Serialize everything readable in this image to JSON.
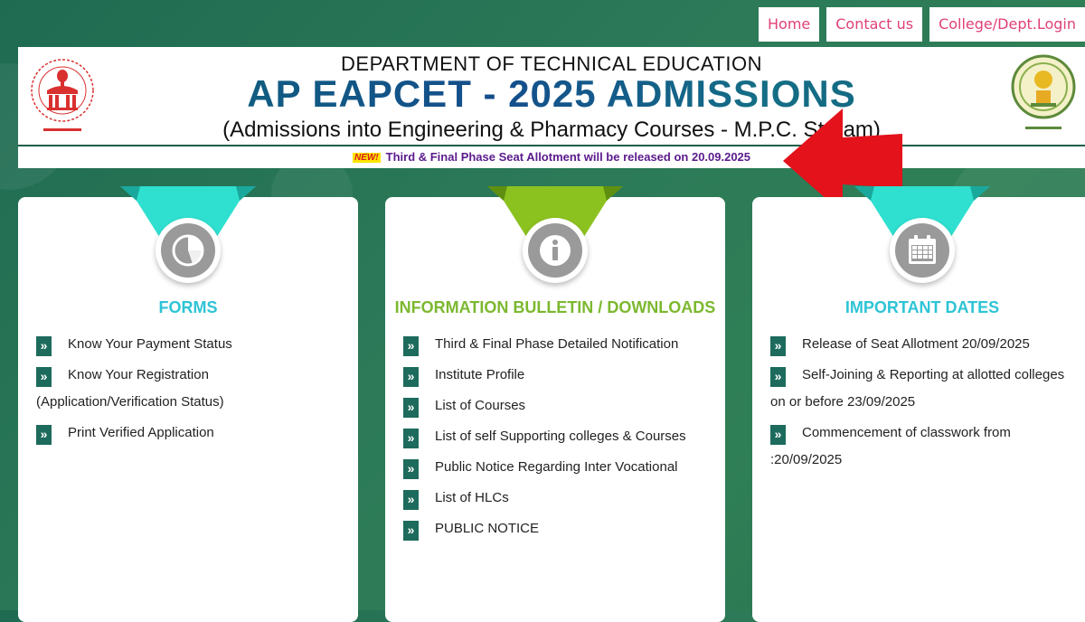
{
  "nav": {
    "items": [
      {
        "label": "Home"
      },
      {
        "label": "Contact us"
      },
      {
        "label": "College/Dept.Login"
      }
    ]
  },
  "banner": {
    "department": "DEPARTMENT OF TECHNICAL EDUCATION",
    "title": "AP EAPCET - 2025 ADMISSIONS",
    "subtitle": "(Admissions into Engineering & Pharmacy Courses - M.P.C. Stream)",
    "new_badge": "NEW!",
    "ticker": "Third & Final Phase Seat Allotment will be released on 20.09.2025"
  },
  "cards": {
    "forms": {
      "heading": "FORMS",
      "color": "#2ec4d6",
      "items": [
        {
          "label": "Know Your Payment Status"
        },
        {
          "label": "Know Your Registration",
          "label2": "(Application/Verification Status)"
        },
        {
          "label": "Print Verified Application"
        }
      ]
    },
    "bulletin": {
      "heading": "INFORMATION BULLETIN / DOWNLOADS",
      "color": "#7cb82f",
      "items": [
        {
          "label": "Third & Final Phase Detailed Notification"
        },
        {
          "label": "Institute Profile"
        },
        {
          "label": "List of Courses"
        },
        {
          "label": "List of self Supporting colleges & Courses"
        },
        {
          "label": "Public Notice Regarding Inter Vocational"
        },
        {
          "label": "List of HLCs"
        },
        {
          "label": "PUBLIC NOTICE"
        }
      ]
    },
    "dates": {
      "heading": "IMPORTANT DATES",
      "color": "#2ec4d6",
      "items": [
        {
          "label": "Release of Seat Allotment 20/09/2025"
        },
        {
          "label": "Self-Joining & Reporting at allotted colleges",
          "label2": "on or before 23/09/2025"
        },
        {
          "label": "Commencement of classwork from",
          "label2": ":20/09/2025"
        }
      ]
    }
  },
  "colors": {
    "nav_text": "#e0407a",
    "chevron": "#1d6b5c",
    "arrow": "#e3121b",
    "ticker": "#5a1a8c"
  },
  "icons": {
    "forms": "pie-chart-icon",
    "bulletin": "info-icon",
    "dates": "calendar-icon",
    "list_bullet": "double-chevron-right-icon"
  }
}
